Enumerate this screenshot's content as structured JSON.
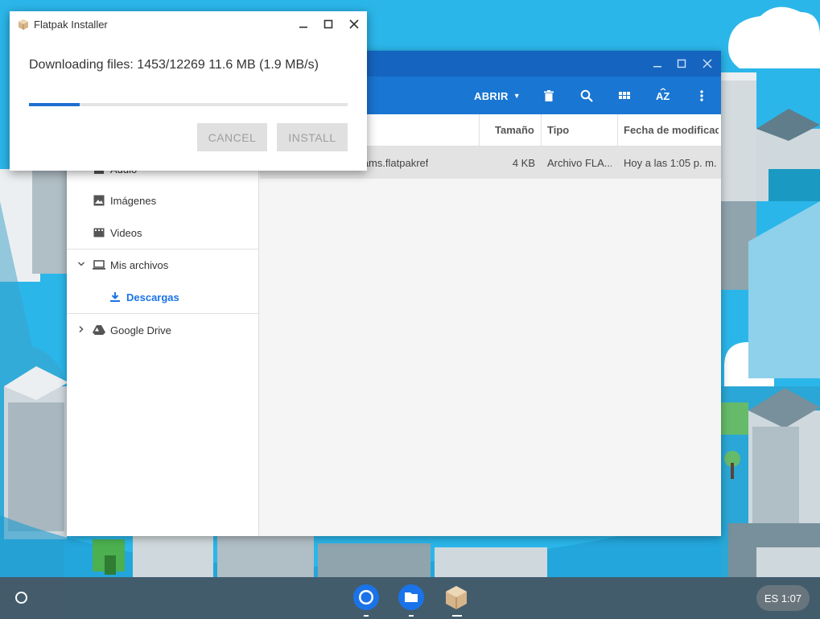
{
  "installer": {
    "title": "Flatpak Installer",
    "status": "Downloading files: 1453/12269 11.6 MB (1.9 MB/s)",
    "progress_fraction": 0.16,
    "cancel_label": "CANCEL",
    "install_label": "INSTALL"
  },
  "files_app": {
    "toolbar": {
      "open_label": "ABRIR"
    },
    "sidebar": {
      "audio_label": "Audio",
      "images_label": "Imágenes",
      "videos_label": "Videos",
      "my_files_label": "Mis archivos",
      "downloads_label": "Descargas",
      "drive_label": "Google Drive"
    },
    "columns": [
      "Tamaño",
      "Tipo",
      "Fecha de modificac"
    ],
    "rows": [
      {
        "name": "Teams.flatpakref",
        "size": "4 KB",
        "type": "Archivo FLA...",
        "modified": "Hoy a las 1:05 p. m."
      }
    ]
  },
  "shelf": {
    "status_text": "ES 1:07"
  },
  "colors": {
    "accent": "#1976d2",
    "titlebar": "#1565c0",
    "progress": "#1e6fd0",
    "link": "#1a73e8"
  }
}
